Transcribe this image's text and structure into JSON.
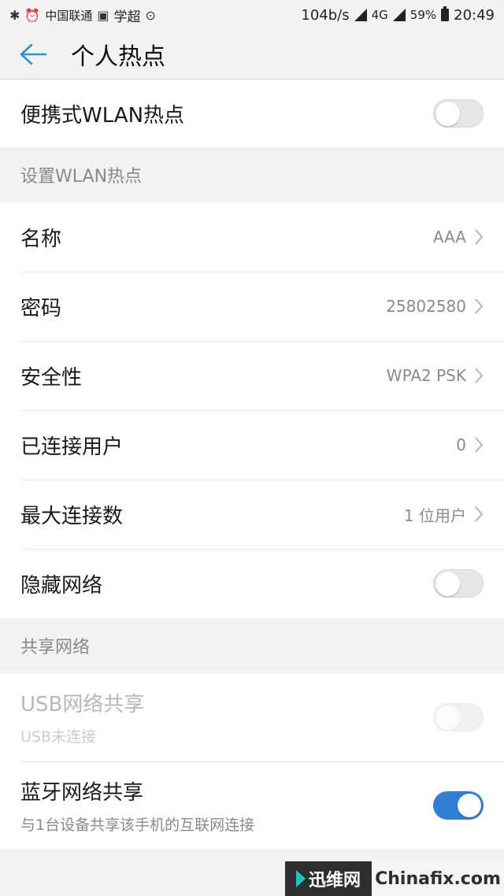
{
  "status_bar": {
    "carrier": "中国联通",
    "app_name": "学超",
    "net_speed": "104b/s",
    "network_type": "4G",
    "battery": "59%",
    "time": "20:49"
  },
  "header": {
    "title": "个人热点"
  },
  "hotspot_toggle": {
    "label": "便携式WLAN热点",
    "state": "off"
  },
  "setup_section": {
    "title": "设置WLAN热点",
    "rows": [
      {
        "label": "名称",
        "value": "AAA"
      },
      {
        "label": "密码",
        "value": "25802580"
      },
      {
        "label": "安全性",
        "value": "WPA2 PSK"
      },
      {
        "label": "已连接用户",
        "value": "0"
      },
      {
        "label": "最大连接数",
        "value": "1 位用户"
      }
    ],
    "hide_network": {
      "label": "隐藏网络",
      "state": "off"
    }
  },
  "share_section": {
    "title": "共享网络",
    "usb": {
      "title": "USB网络共享",
      "subtitle": "USB未连接",
      "state": "disabled"
    },
    "bluetooth": {
      "title": "蓝牙网络共享",
      "subtitle": "与1台设备共享该手机的互联网连接",
      "state": "on"
    }
  },
  "watermark": {
    "left_text": "迅维网",
    "right_text": "Chinafix.com"
  },
  "colors": {
    "accent": "#2d7fd8",
    "background": "#f2f2f2"
  }
}
